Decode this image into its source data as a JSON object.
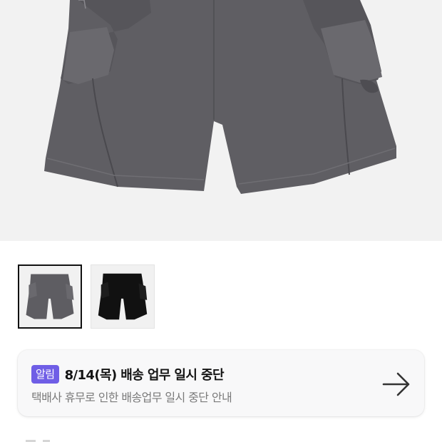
{
  "product": {
    "main_image": "grey cargo shorts photo",
    "thumbnails": [
      {
        "name": "grey-shorts-thumbnail",
        "color": "#5e5d62",
        "selected": true
      },
      {
        "name": "black-shorts-thumbnail",
        "color": "#111111",
        "selected": false
      }
    ]
  },
  "notice": {
    "badge": "알림",
    "title": "8/14(목) 배송 업무 일시 중단",
    "subtitle": "택배사 휴무로 인한 배송업무 일시 중단 안내",
    "arrow_icon": "arrow-right-icon"
  },
  "colors": {
    "badge_bg": "#6f5ee6",
    "hero_bg": "#f2f2f2",
    "card_bg": "#f8f8f9"
  }
}
